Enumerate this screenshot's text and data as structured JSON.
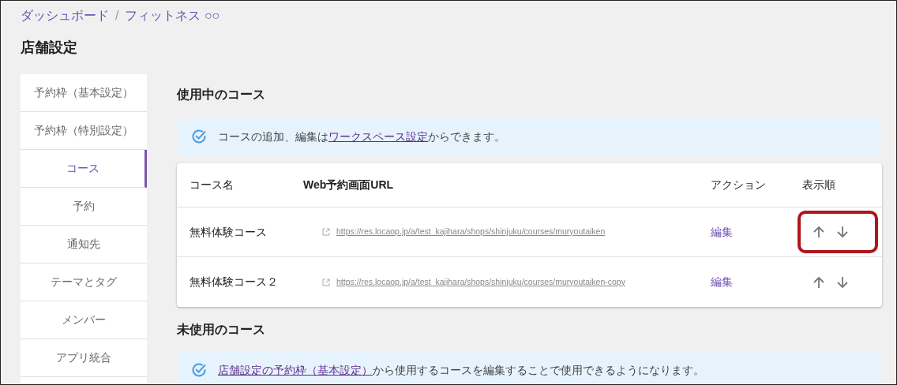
{
  "breadcrumb": {
    "separator": "/",
    "items": [
      "ダッシュボード",
      "フィットネス ○○"
    ]
  },
  "page_title": "店舗設定",
  "sidebar": {
    "items": [
      {
        "label": "予約枠（基本設定）",
        "selected": false
      },
      {
        "label": "予約枠（特別設定）",
        "selected": false
      },
      {
        "label": "コース",
        "selected": true
      },
      {
        "label": "予約",
        "selected": false
      },
      {
        "label": "通知先",
        "selected": false
      },
      {
        "label": "テーマとタグ",
        "selected": false
      },
      {
        "label": "メンバー",
        "selected": false
      },
      {
        "label": "アプリ統合",
        "selected": false
      }
    ]
  },
  "active_courses": {
    "heading": "使用中のコース",
    "notice": {
      "before": "コースの追加、編集は",
      "link": "ワークスペース設定",
      "after": "からできます。"
    },
    "table": {
      "columns": [
        "コース名",
        "Web予約画面URL",
        "アクション",
        "表示順"
      ],
      "rows": [
        {
          "name": "無料体験コース",
          "url": "https://res.locaop.jp/a/test_kajihara/shops/shinjuku/courses/muryoutaiken",
          "action": "編集",
          "highlighted": true
        },
        {
          "name": "無料体験コース２",
          "url": "https://res.locaop.jp/a/test_kajihara/shops/shinjuku/courses/muryoutaiken-copy",
          "action": "編集",
          "highlighted": false
        }
      ]
    }
  },
  "unused_courses": {
    "heading": "未使用のコース",
    "notice": {
      "link": "店舗設定の予約枠（基本設定）",
      "after": "から使用するコースを編集することで使用できるようになります。"
    }
  }
}
